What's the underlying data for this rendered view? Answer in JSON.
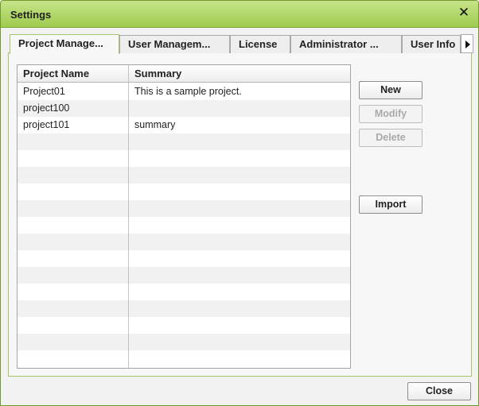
{
  "window": {
    "title": "Settings",
    "close_glyph": "✕"
  },
  "tabs": [
    {
      "label": "Project Manage...",
      "active": true
    },
    {
      "label": "User Managem..."
    },
    {
      "label": "License"
    },
    {
      "label": "Administrator ..."
    },
    {
      "label": "User Info"
    }
  ],
  "tab_scroll_icon": "arrow-right-icon",
  "grid": {
    "columns": [
      "Project Name",
      "Summary"
    ],
    "rows": [
      {
        "name": "Project01",
        "summary": "This is a sample project."
      },
      {
        "name": "project100",
        "summary": ""
      },
      {
        "name": "project101",
        "summary": "summary"
      }
    ]
  },
  "actions": {
    "new": "New",
    "modify": "Modify",
    "delete": "Delete",
    "import": "Import"
  },
  "footer": {
    "close": "Close"
  }
}
